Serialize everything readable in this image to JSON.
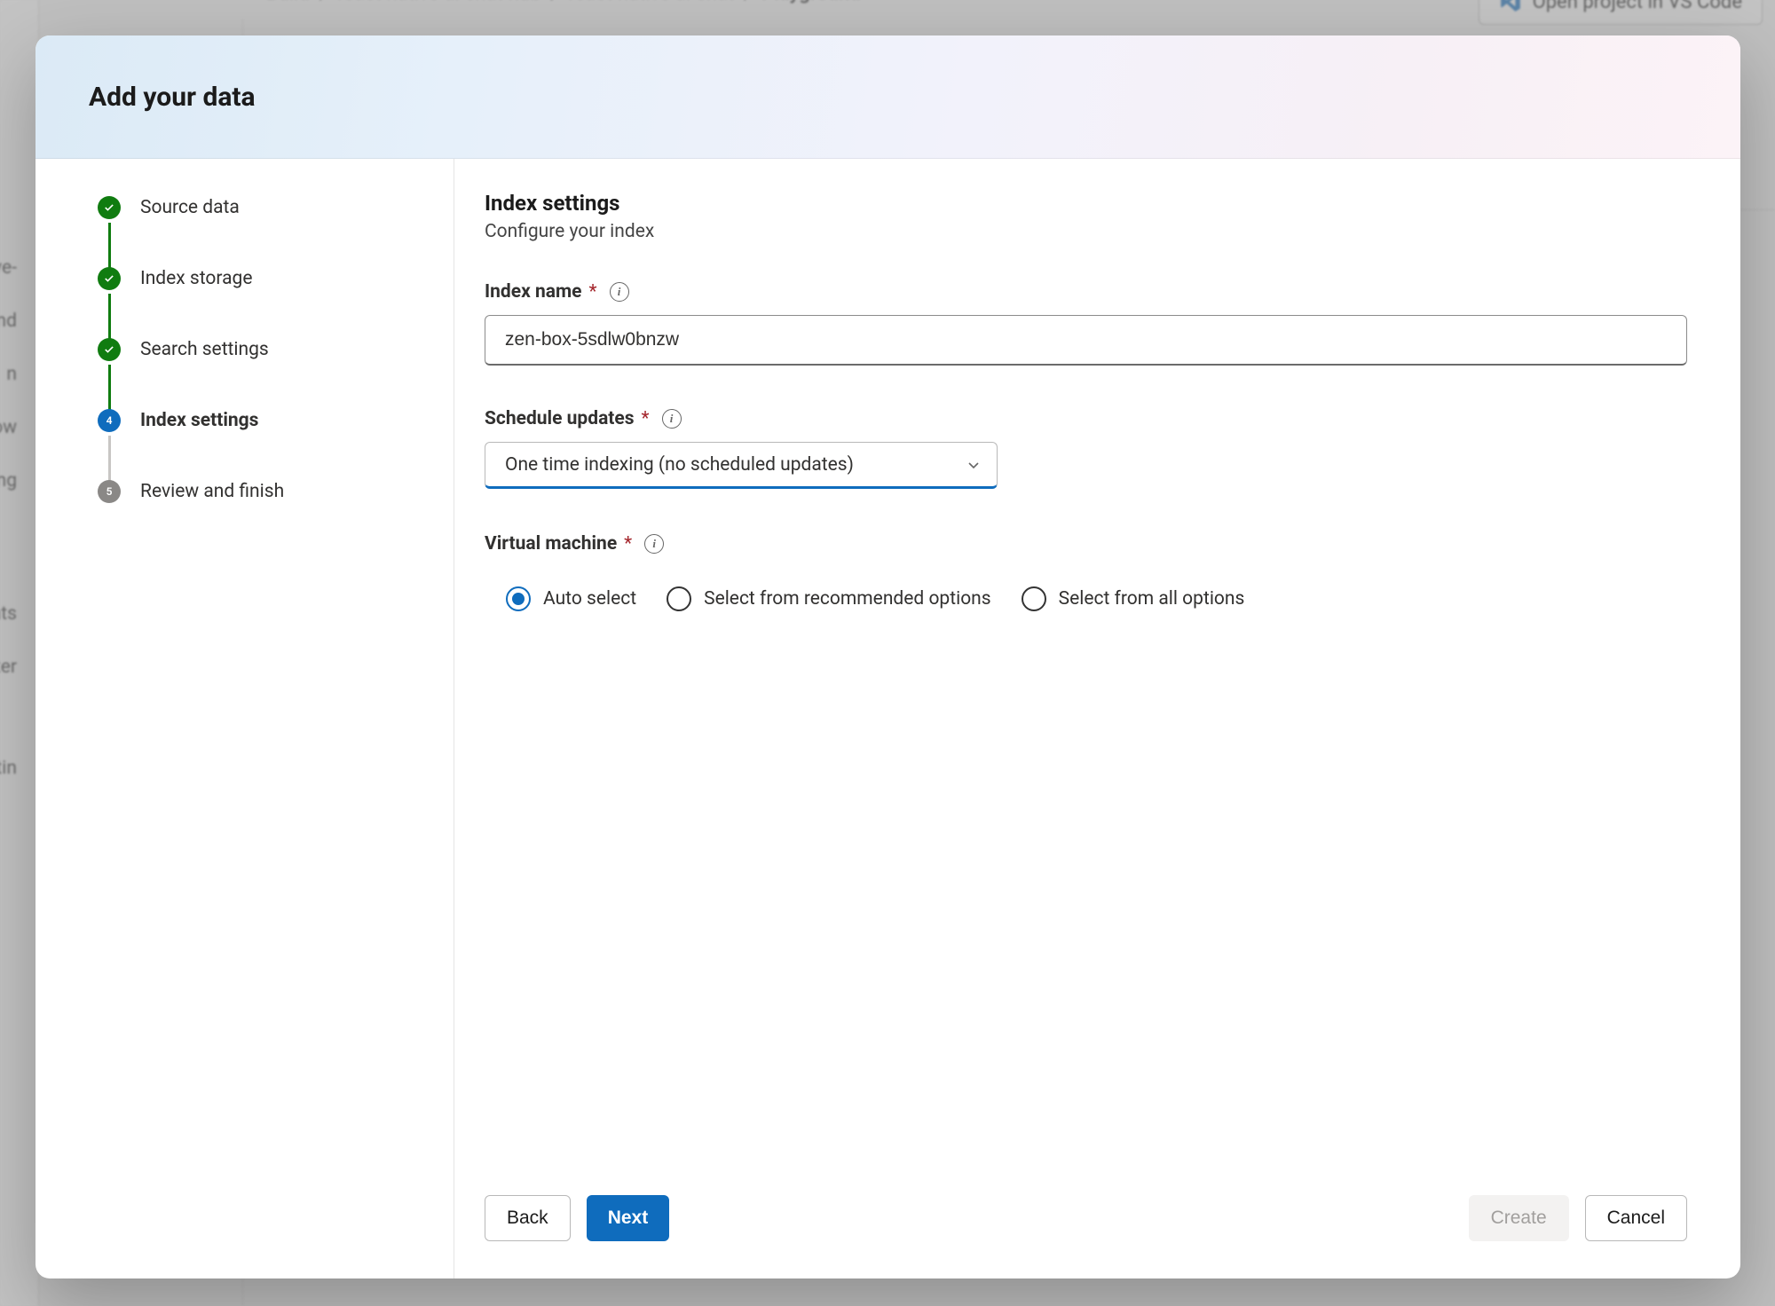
{
  "background": {
    "breadcrumb": [
      "Build",
      "react-native-ai-chat-hub",
      "react-native-ai-chat",
      "Playground"
    ],
    "open_project_label": "Open project in VS Code",
    "left_nav": [
      "ve-",
      "nd",
      "n",
      "ow",
      "ng",
      "ents",
      "lter",
      "ttin"
    ]
  },
  "modal": {
    "title": "Add your data",
    "steps": [
      {
        "label": "Source data",
        "state": "done"
      },
      {
        "label": "Index storage",
        "state": "done"
      },
      {
        "label": "Search settings",
        "state": "done"
      },
      {
        "label": "Index settings",
        "state": "current",
        "number": "4"
      },
      {
        "label": "Review and finish",
        "state": "upcoming",
        "number": "5"
      }
    ],
    "content": {
      "heading": "Index settings",
      "subheading": "Configure your index",
      "index_name_label": "Index name",
      "index_name_value": "zen-box-5sdlw0bnzw",
      "schedule_label": "Schedule updates",
      "schedule_value": "One time indexing (no scheduled updates)",
      "vm_label": "Virtual machine",
      "vm_options": [
        {
          "label": "Auto select",
          "selected": true
        },
        {
          "label": "Select from recommended options",
          "selected": false
        },
        {
          "label": "Select from all options",
          "selected": false
        }
      ]
    },
    "footer": {
      "back": "Back",
      "next": "Next",
      "create": "Create",
      "cancel": "Cancel"
    }
  }
}
